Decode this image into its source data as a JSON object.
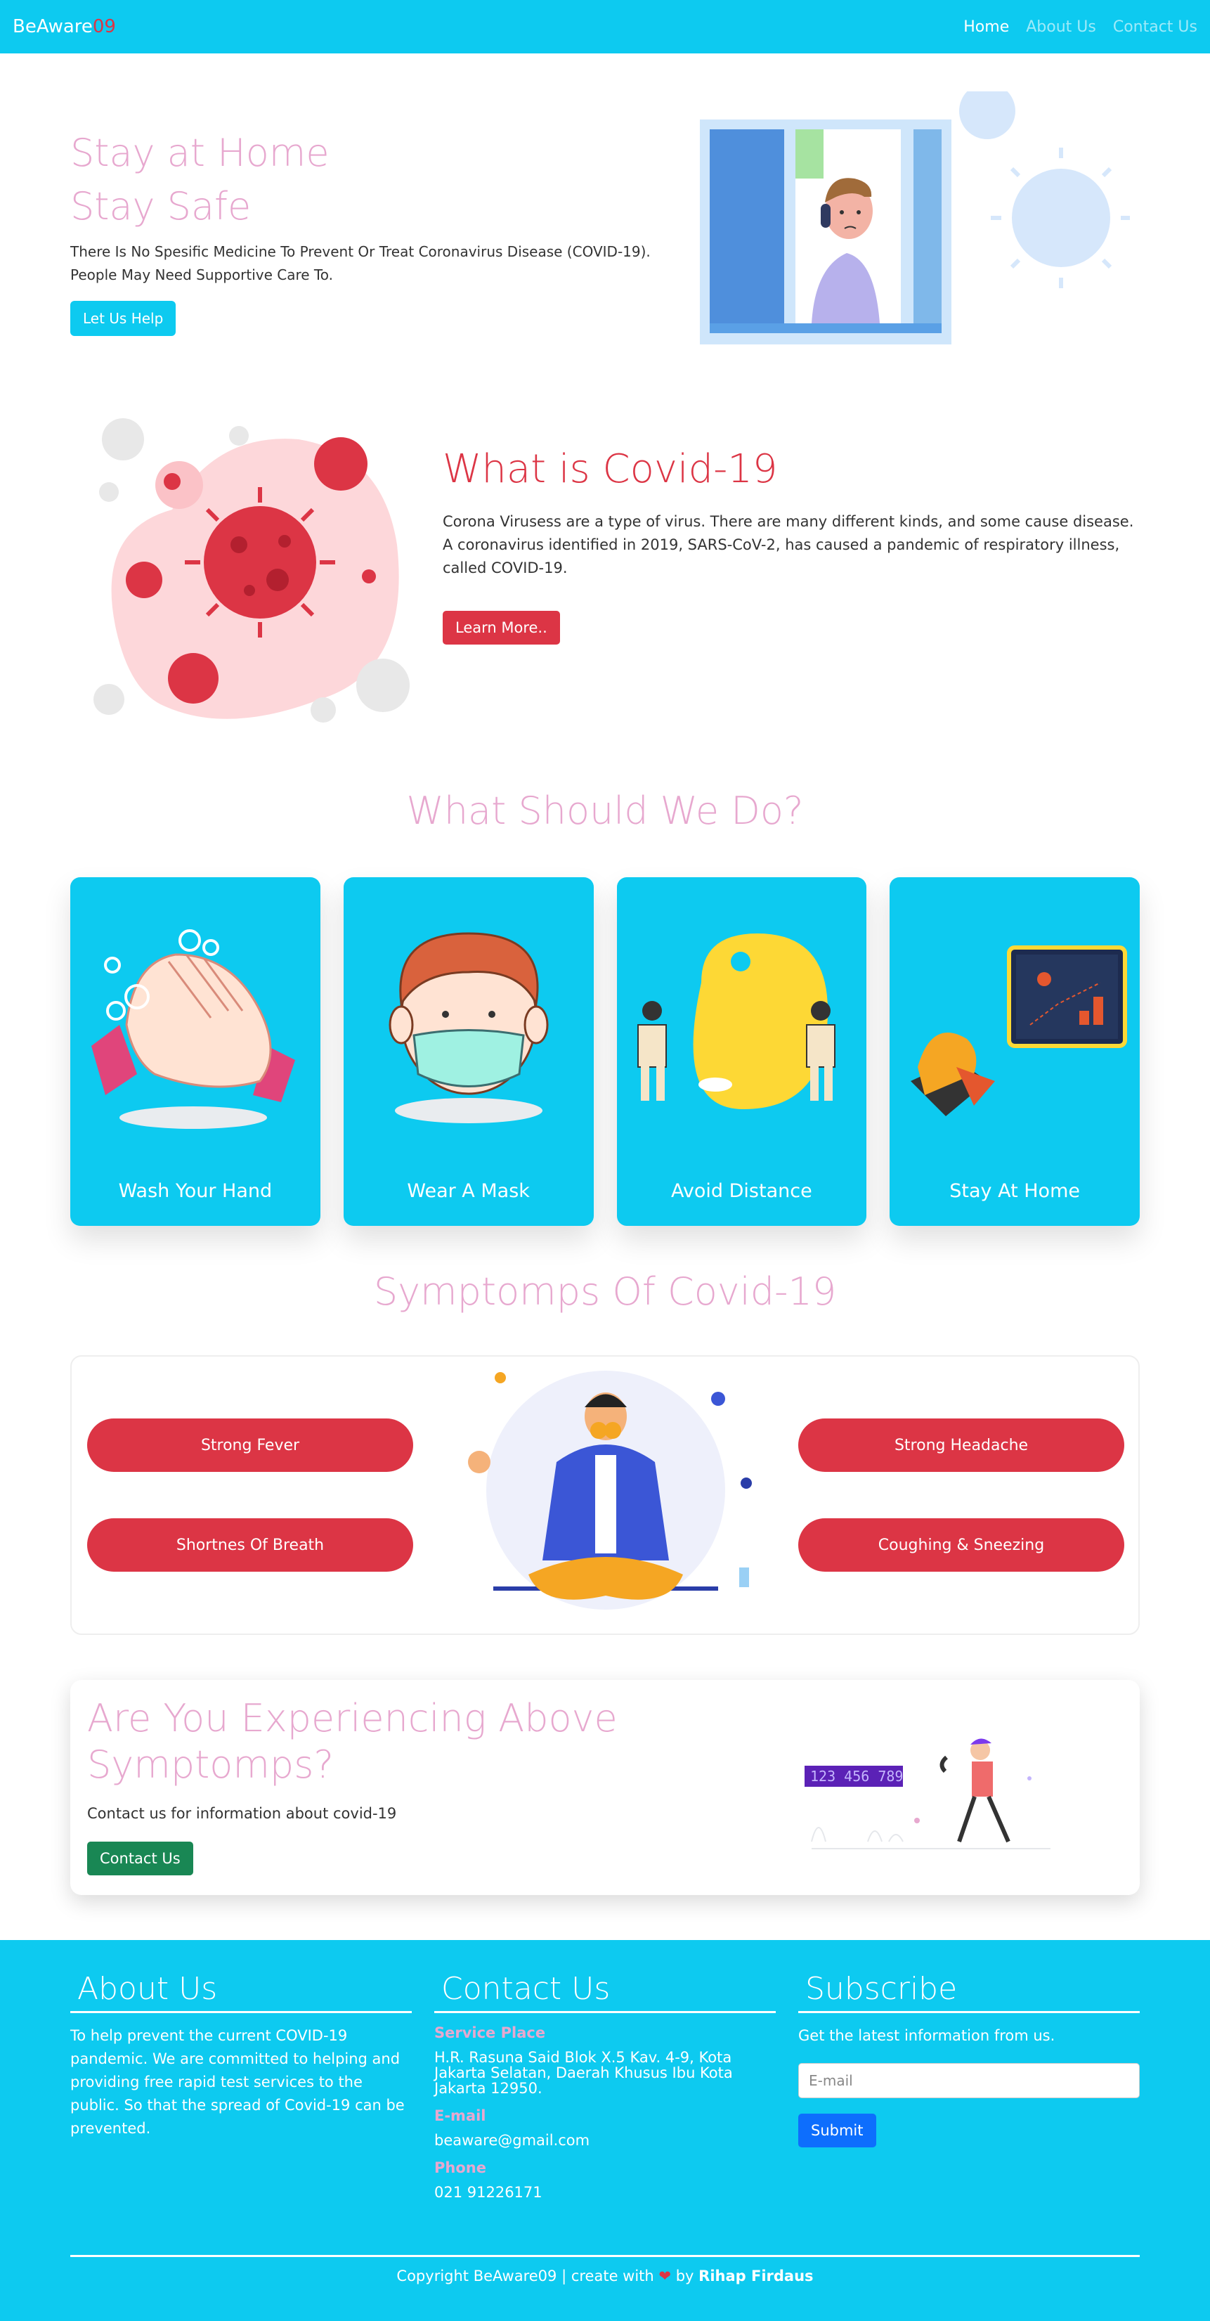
{
  "nav": {
    "brand_main": "BeAware",
    "brand_accent": "09",
    "links": [
      "Home",
      "About Us",
      "Contact Us"
    ]
  },
  "hero": {
    "title_line1": "Stay at Home",
    "title_line2": "Stay Safe",
    "text": "There Is No Spesific Medicine To Prevent Or Treat Coronavirus Disease (COVID-19). People May Need Supportive Care To.",
    "button": "Let Us Help"
  },
  "covid": {
    "title": "What is Covid-19",
    "text": "Corona Virusess are a type of virus. There are many different kinds, and some cause disease. A coronavirus identified in 2019, SARS-CoV-2, has caused a pandemic of respiratory illness, called COVID-19.",
    "button": "Learn More.."
  },
  "todo": {
    "title": "What Should We Do?",
    "cards": [
      "Wash Your Hand",
      "Wear A Mask",
      "Avoid Distance",
      "Stay At Home"
    ]
  },
  "symptoms": {
    "title": "Symptomps Of Covid-19",
    "items": [
      "Strong Fever",
      "Shortnes Of Breath",
      "Strong Headache",
      "Coughing & Sneezing"
    ]
  },
  "experience": {
    "title": "Are You Experiencing Above Symptomps?",
    "text": "Contact us for information about covid-19",
    "button": "Contact Us",
    "phone_display": "123 456 789"
  },
  "footer": {
    "about_title": "About Us",
    "about_text": "To help prevent the current COVID-19 pandemic. We are committed to helping and providing free rapid test services to the public. So that the spread of Covid-19 can be prevented.",
    "contact_title": "Contact Us",
    "service_label": "Service Place",
    "service_value": "H.R. Rasuna Said Blok X.5 Kav. 4-9, Kota Jakarta Selatan, Daerah Khusus Ibu Kota Jakarta 12950.",
    "email_label": "E-mail",
    "email_value": "beaware@gmail.com",
    "phone_label": "Phone",
    "phone_value": "021 91226171",
    "subscribe_title": "Subscribe",
    "subscribe_text": "Get the latest information from us.",
    "email_placeholder": "E-mail",
    "submit": "Submit",
    "copyright_pre": "Copyright BeAware09 | create with",
    "copyright_by": "by",
    "author": "Rihap Firdaus"
  },
  "colors": {
    "primary": "#0dcaf0",
    "pink": "#e7a8cf",
    "danger": "#dc3545",
    "success": "#198754",
    "blue": "#0d6efd"
  }
}
